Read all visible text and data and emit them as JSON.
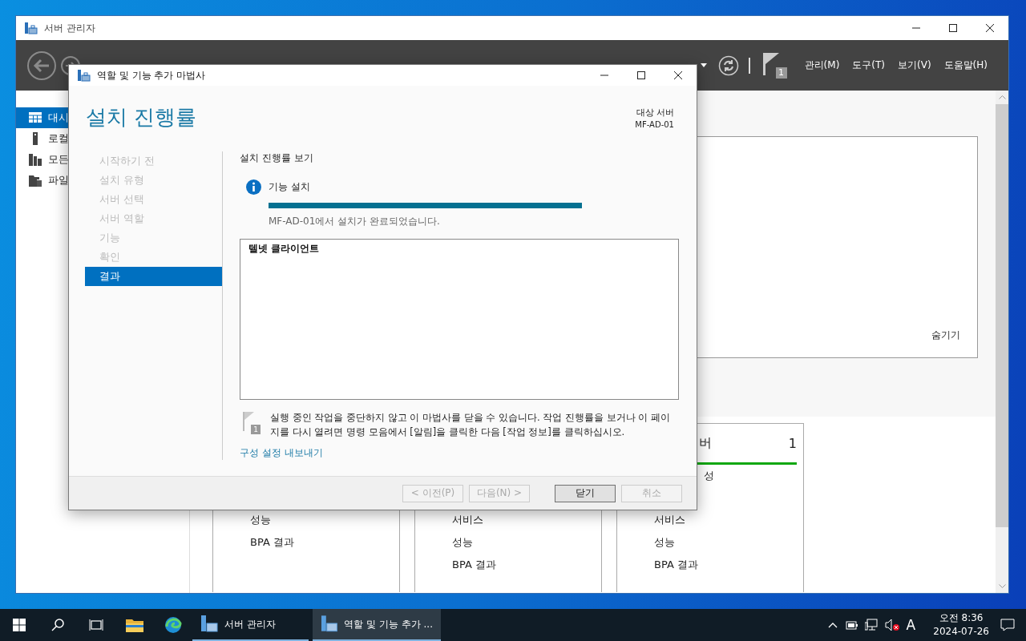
{
  "server_manager": {
    "title": "서버 관리자",
    "menus": [
      "관리(M)",
      "도구(T)",
      "보기(V)",
      "도움말(H)"
    ],
    "notification_count": "1",
    "sidebar": [
      {
        "label": "대시",
        "selected": true
      },
      {
        "label": "로컬",
        "selected": false
      },
      {
        "label": "모든",
        "selected": false
      },
      {
        "label": "파일",
        "selected": false
      }
    ],
    "welcome_panel": {
      "hide_link": "숨기기"
    },
    "tiles": [
      {
        "items": [
          "성능",
          "BPA 결과"
        ]
      },
      {
        "items": [
          "서비스",
          "성능",
          "BPA 결과"
        ]
      },
      {
        "title": "버",
        "count": "1",
        "items_top": [
          "성"
        ],
        "items": [
          "서비스",
          "성능",
          "BPA 결과"
        ]
      }
    ]
  },
  "wizard": {
    "title": "역할 및 기능 추가 마법사",
    "heading": "설치 진행률",
    "target_server": {
      "label": "대상 서버",
      "value": "MF-AD-01"
    },
    "steps": [
      {
        "label": "시작하기 전",
        "selected": false
      },
      {
        "label": "설치 유형",
        "selected": false
      },
      {
        "label": "서버 선택",
        "selected": false
      },
      {
        "label": "서버 역할",
        "selected": false
      },
      {
        "label": "기능",
        "selected": false
      },
      {
        "label": "확인",
        "selected": false
      },
      {
        "label": "결과",
        "selected": true
      }
    ],
    "section_title": "설치 진행률 보기",
    "status": {
      "label": "기능 설치",
      "level": 1,
      "message": "MF-AD-01에서 설치가 완료되었습니다."
    },
    "results": [
      "텔넷 클라이언트"
    ],
    "note_flag_count": "1",
    "note": "실행 중인 작업을 중단하지 않고 이 마법사를 닫을 수 있습니다. 작업 진행률을 보거나 이 페이지를 다시 열려면 명령 모음에서 [알림]을 클릭한 다음 [작업 정보]를 클릭하십시오.",
    "export_link": "구성 설정 내보내기",
    "buttons": [
      {
        "label": "< 이전(P)",
        "disabled": true,
        "default": false
      },
      {
        "label": "다음(N) >",
        "disabled": true,
        "default": false
      },
      {
        "label": "닫기",
        "disabled": false,
        "default": true
      },
      {
        "label": "취소",
        "disabled": true,
        "default": false
      }
    ]
  },
  "taskbar": {
    "apps": [
      {
        "label": "서버 관리자",
        "selected": false
      },
      {
        "label": "역할 및 기능 추가 ...",
        "selected": true
      }
    ],
    "input_indicator": "A",
    "clock": {
      "time": "오전 8:36",
      "date": "2024-07-26"
    }
  }
}
